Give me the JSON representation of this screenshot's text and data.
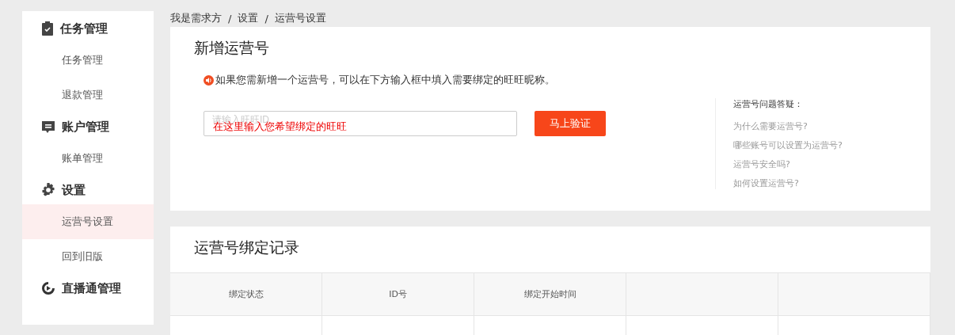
{
  "sidebar": {
    "groups": [
      {
        "label": "任务管理",
        "items": [
          {
            "label": "任务管理",
            "selected": false
          },
          {
            "label": "退款管理",
            "selected": false
          }
        ]
      },
      {
        "label": "账户管理",
        "items": [
          {
            "label": "账单管理",
            "selected": false
          }
        ]
      },
      {
        "label": "设置",
        "items": [
          {
            "label": "运营号设置",
            "selected": true
          },
          {
            "label": "回到旧版",
            "selected": false
          }
        ]
      },
      {
        "label": "直播通管理"
      }
    ]
  },
  "breadcrumb": {
    "items": [
      "我是需求方",
      "设置",
      "运营号设置"
    ],
    "separator": "/"
  },
  "add_card": {
    "title": "新增运营号",
    "notice": "如果您需新增一个运营号，可以在下方输入框中填入需要绑定的旺旺昵称。",
    "input": {
      "placeholder": "请输入旺旺ID"
    },
    "annotation": "在这里输入您希望绑定的旺旺",
    "button": "马上验证",
    "faq": {
      "title": "运营号问题答疑：",
      "links": [
        "为什么需要运营号?",
        "哪些账号可以设置为运营号?",
        "运营号安全吗?",
        "如何设置运营号?"
      ]
    }
  },
  "records_card": {
    "title": "运营号绑定记录",
    "table": {
      "columns": [
        "绑定状态",
        "ID号",
        "绑定开始时间"
      ]
    }
  }
}
